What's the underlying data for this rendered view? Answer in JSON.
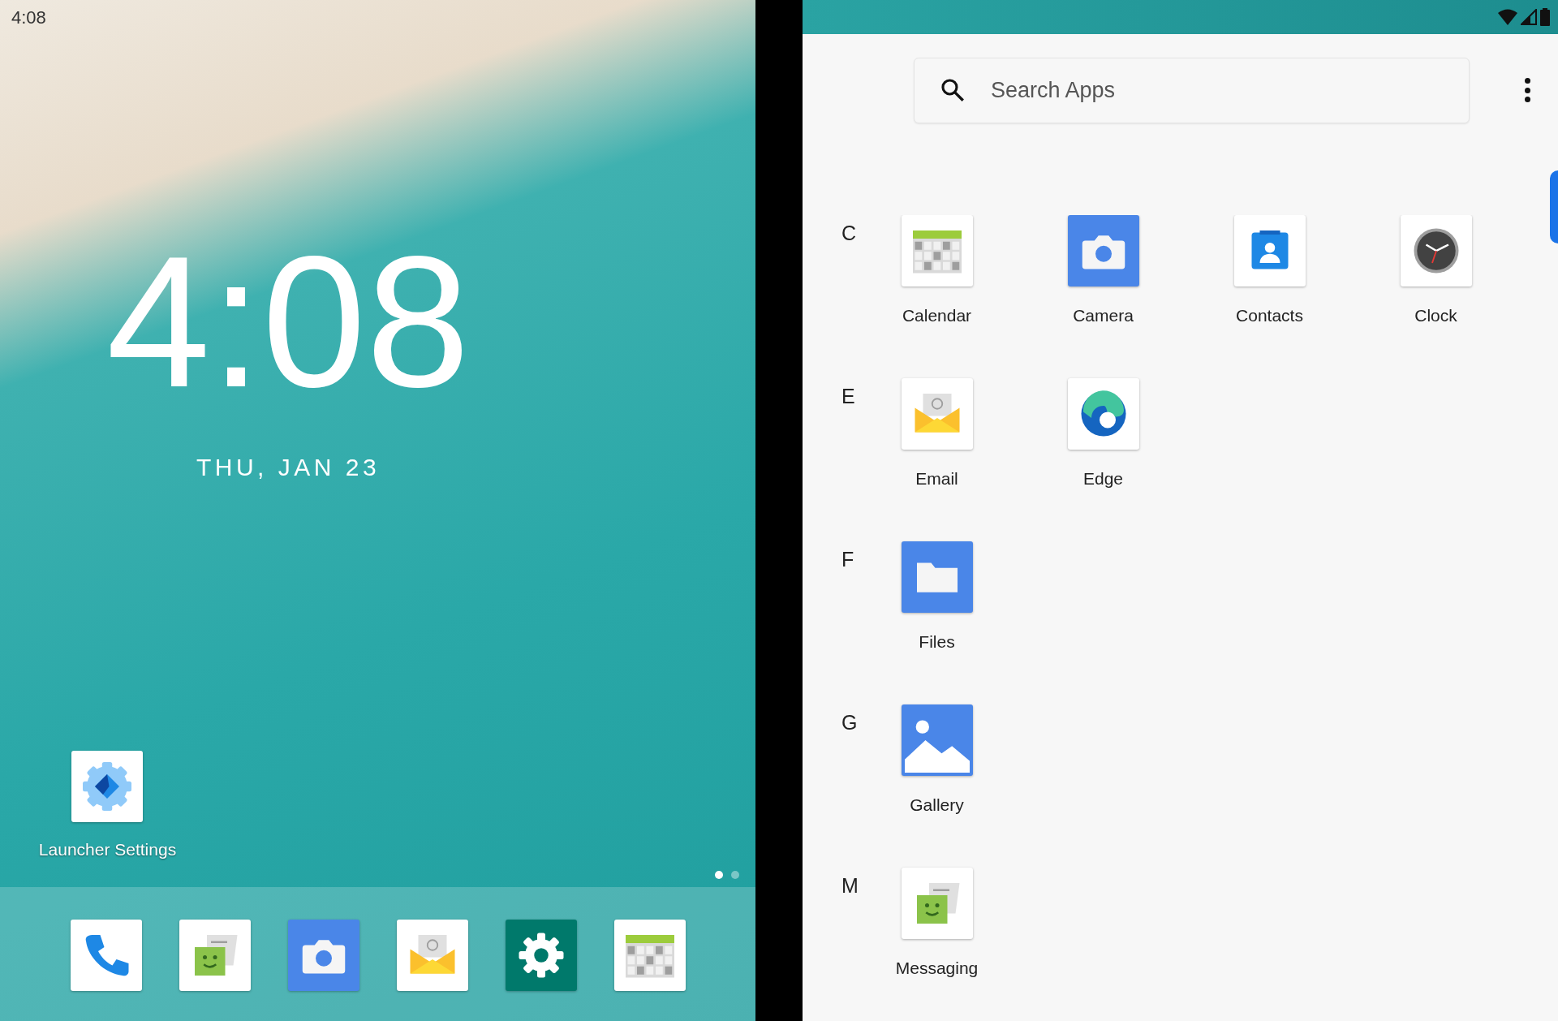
{
  "home": {
    "status_time": "4:08",
    "clock": "4:08",
    "date": "THU, JAN 23",
    "shortcut": {
      "kind": "launcher",
      "label": "Launcher Settings"
    },
    "page_dots": [
      {
        "selected": true
      },
      {
        "selected": false
      }
    ],
    "dock": [
      {
        "kind": "phone"
      },
      {
        "kind": "messaging"
      },
      {
        "kind": "camera"
      },
      {
        "kind": "email"
      },
      {
        "kind": "settings"
      },
      {
        "kind": "calendar"
      }
    ]
  },
  "drawer": {
    "search": {
      "placeholder": "Search Apps"
    },
    "sections": [
      {
        "letter": "C",
        "apps": [
          {
            "kind": "calendar",
            "label": "Calendar"
          },
          {
            "kind": "camera",
            "label": "Camera"
          },
          {
            "kind": "contacts",
            "label": "Contacts"
          },
          {
            "kind": "clock",
            "label": "Clock"
          }
        ]
      },
      {
        "letter": "E",
        "apps": [
          {
            "kind": "email",
            "label": "Email"
          },
          {
            "kind": "edge",
            "label": "Edge"
          }
        ]
      },
      {
        "letter": "F",
        "apps": [
          {
            "kind": "files",
            "label": "Files"
          }
        ]
      },
      {
        "letter": "G",
        "apps": [
          {
            "kind": "gallery",
            "label": "Gallery"
          }
        ]
      },
      {
        "letter": "M",
        "apps": [
          {
            "kind": "messaging",
            "label": "Messaging"
          }
        ]
      }
    ]
  }
}
